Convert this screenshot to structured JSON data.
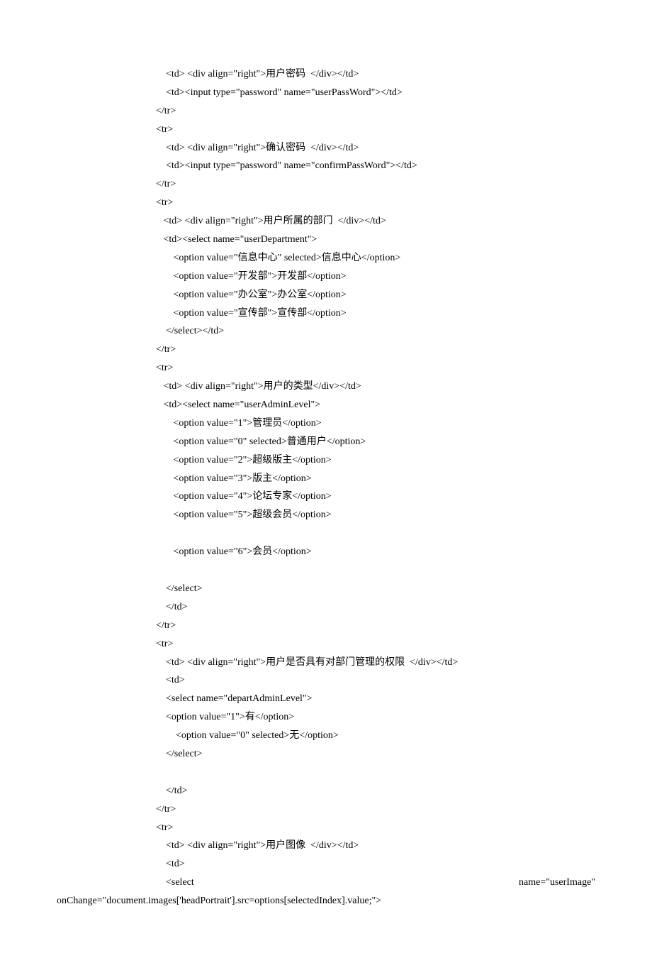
{
  "lines": [
    "    <td> <div align=\"right\">用户密码  </div></td>",
    "    <td><input type=\"password\" name=\"userPassWord\"></td>",
    "</tr>",
    "<tr>",
    "    <td> <div align=\"right\">确认密码  </div></td>",
    "    <td><input type=\"password\" name=\"confirmPassWord\"></td>",
    "</tr>",
    "<tr>",
    "   <td> <div align=\"right\">用户所属的部门  </div></td>",
    "   <td><select name=\"userDepartment\">",
    "       <option value=\"信息中心\" selected>信息中心</option>",
    "       <option value=\"开发部\">开发部</option>",
    "       <option value=\"办公室\">办公室</option>",
    "       <option value=\"宣传部\">宣传部</option>",
    "    </select></td>",
    "</tr>",
    "<tr>",
    "   <td> <div align=\"right\">用户的类型</div></td>",
    "   <td><select name=\"userAdminLevel\">",
    "       <option value=\"1\">管理员</option>",
    "       <option value=\"0\" selected>普通用户</option>",
    "       <option value=\"2\">超级版主</option>",
    "       <option value=\"3\">版主</option>",
    "       <option value=\"4\">论坛专家</option>",
    "       <option value=\"5\">超级会员</option>",
    "",
    "       <option value=\"6\">会员</option>",
    "",
    "    </select>",
    "    </td>",
    "</tr>",
    "<tr>",
    "    <td> <div align=\"right\">用户是否具有对部门管理的权限  </div></td>",
    "    <td>",
    "    <select name=\"departAdminLevel\">",
    "    <option value=\"1\">有</option>",
    "        <option value=\"0\" selected>无</option>",
    "    </select>",
    "",
    "    </td>",
    "</tr>",
    "<tr>",
    "    <td> <div align=\"right\">用户图像  </div></td>",
    "    <td>"
  ],
  "justified": {
    "left": "    <select",
    "right": "name=\"userImage\""
  },
  "lastLine": "onChange=\"document.images['headPortrait'].src=options[selectedIndex].value;\">"
}
